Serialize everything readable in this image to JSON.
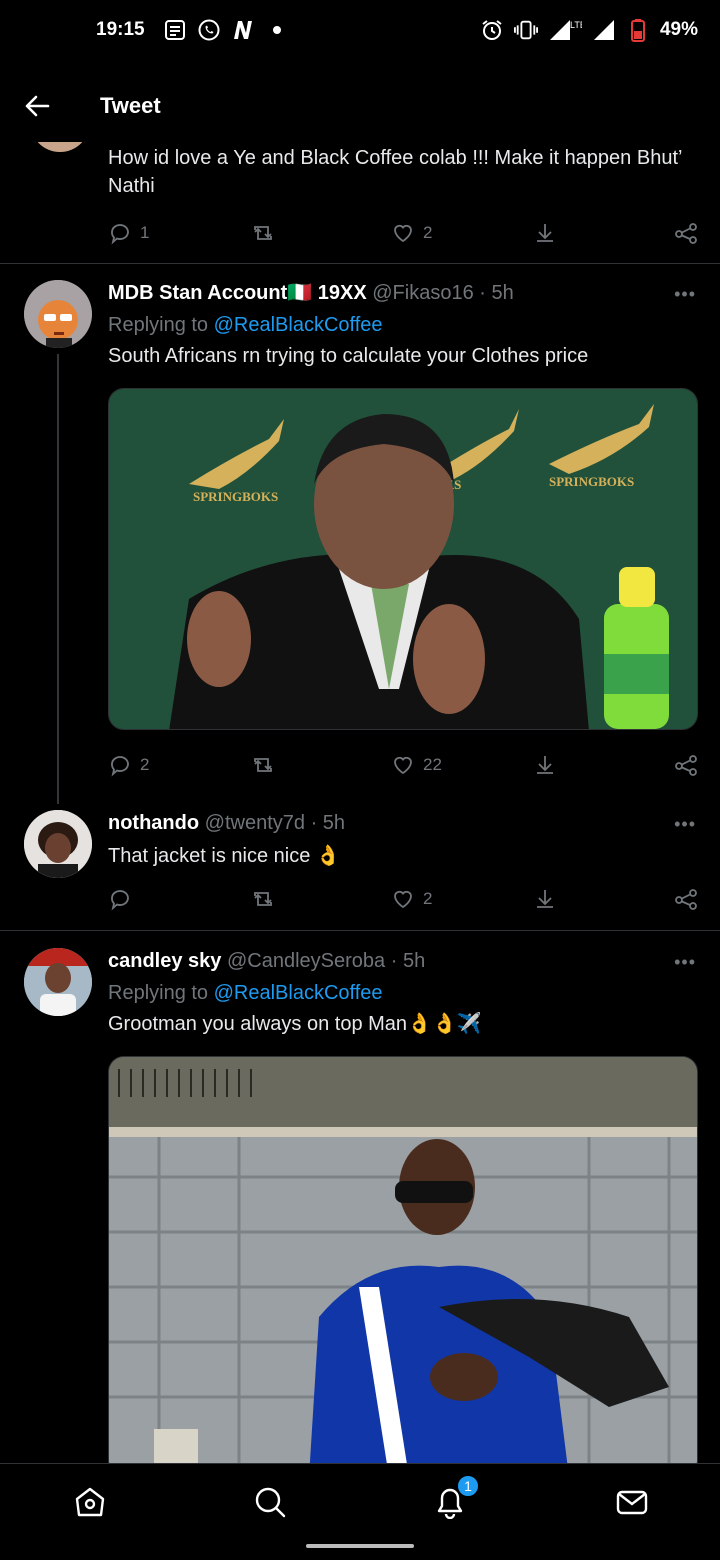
{
  "status_bar": {
    "time": "19:15",
    "battery": "49%",
    "network": "LTE",
    "icons_left": [
      "news-icon",
      "whatsapp-icon",
      "netflix-icon",
      "dot-icon"
    ],
    "icons_right": [
      "alarm-icon",
      "vibrate-icon",
      "signal-lte-icon",
      "signal-icon",
      "battery-icon"
    ]
  },
  "header": {
    "title": "Tweet"
  },
  "tweets": [
    {
      "text": "How id love a Ye and Black Coffee colab !!! Make it happen Bhut’ Nathi",
      "replies": "1",
      "retweets": "",
      "likes": "2"
    },
    {
      "name": "MDB Stan Account",
      "flag": "🇮🇹",
      "name_suffix": "19XX",
      "handle": "@Fikaso16",
      "time": "· 5h",
      "replying_label": "Replying to",
      "replying_to": "@RealBlackCoffee",
      "text": "South Africans rn trying to calculate your Clothes price",
      "media_text": [
        "SPRINGBOKS",
        "KS",
        "SPRINGBOKS"
      ],
      "replies": "2",
      "retweets": "",
      "likes": "22"
    },
    {
      "name": "nothando",
      "handle": "@twenty7d",
      "time": "· 5h",
      "text": "That jacket is nice nice 👌",
      "replies": "",
      "retweets": "",
      "likes": "2"
    },
    {
      "name": "candley sky",
      "handle": "@CandleySeroba",
      "time": "· 5h",
      "replying_label": "Replying to",
      "replying_to": "@RealBlackCoffee",
      "text": "Grootman you always on top Man👌👌✈️"
    }
  ],
  "more_label": "•••",
  "bottom_nav": {
    "items": [
      "home-icon",
      "search-icon",
      "notifications-icon",
      "messages-icon"
    ],
    "notification_badge": "1"
  },
  "colors": {
    "accent": "#1d9bf0",
    "background": "#000000",
    "muted": "#71767b",
    "divider": "#2f3336"
  }
}
